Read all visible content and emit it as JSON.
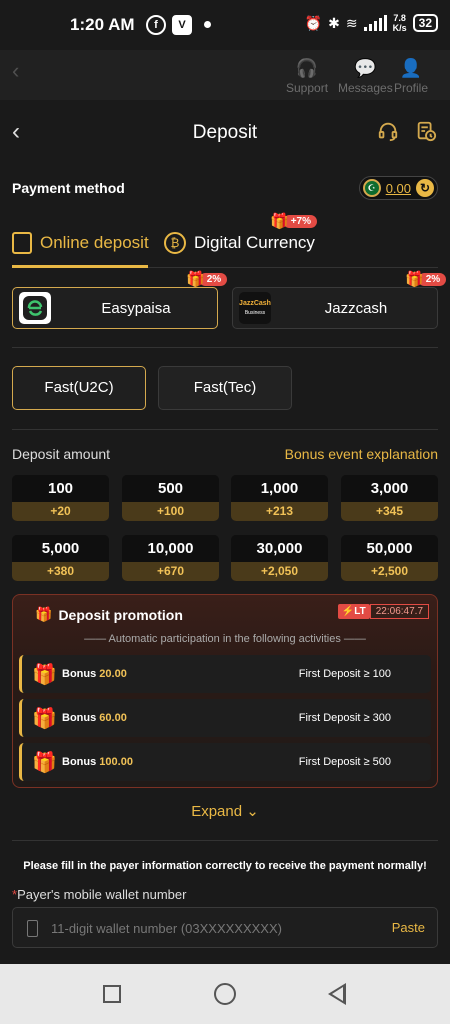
{
  "status_bar": {
    "time": "1:20 AM",
    "speed_value": "7.8",
    "speed_unit": "K/s",
    "battery": "32"
  },
  "background_nav": {
    "support_label": "Support",
    "messages_label": "Messages",
    "profile_label": "Profile"
  },
  "header": {
    "title": "Deposit"
  },
  "payment_method": {
    "label": "Payment method",
    "balance": "0.00"
  },
  "tabs": [
    {
      "label": "Online deposit",
      "active": true
    },
    {
      "label": "Digital Currency",
      "active": false,
      "badge": "+7%"
    }
  ],
  "wallets": [
    {
      "name": "Easypaisa",
      "badge": "2%",
      "selected": true
    },
    {
      "name": "Jazzcash",
      "badge": "2%",
      "selected": false,
      "logo_text": "JazzCash",
      "logo_sub": "Business"
    }
  ],
  "channels": [
    {
      "label": "Fast(U2C)",
      "selected": true
    },
    {
      "label": "Fast(Tec)",
      "selected": false
    }
  ],
  "deposit_amount": {
    "label": "Deposit amount",
    "bonus_link": "Bonus event explanation",
    "options": [
      {
        "amount": "100",
        "bonus": "+20"
      },
      {
        "amount": "500",
        "bonus": "+100"
      },
      {
        "amount": "1,000",
        "bonus": "+213"
      },
      {
        "amount": "3,000",
        "bonus": "+345"
      },
      {
        "amount": "5,000",
        "bonus": "+380"
      },
      {
        "amount": "10,000",
        "bonus": "+670"
      },
      {
        "amount": "30,000",
        "bonus": "+2,050"
      },
      {
        "amount": "50,000",
        "bonus": "+2,500"
      }
    ]
  },
  "promotion": {
    "title": "Deposit promotion",
    "lt_tag": "LT",
    "countdown": "22:06:47.7",
    "subtitle": "Automatic participation in the following activities",
    "rows": [
      {
        "bonus_label": "Bonus",
        "bonus_value": "20.00",
        "condition": "First Deposit ≥ 100"
      },
      {
        "bonus_label": "Bonus",
        "bonus_value": "60.00",
        "condition": "First Deposit ≥ 300"
      },
      {
        "bonus_label": "Bonus",
        "bonus_value": "100.00",
        "condition": "First Deposit ≥ 500"
      }
    ]
  },
  "expand_label": "Expand",
  "notice": "Please fill in the payer information correctly to receive the payment normally!",
  "wallet_field": {
    "label": "Payer's mobile wallet number",
    "placeholder": "11-digit wallet number (03XXXXXXXXX)",
    "value": "",
    "paste_label": "Paste"
  },
  "colors": {
    "accent": "#e9b845",
    "background": "#1a1a1a",
    "badge_red": "#e34b44"
  }
}
